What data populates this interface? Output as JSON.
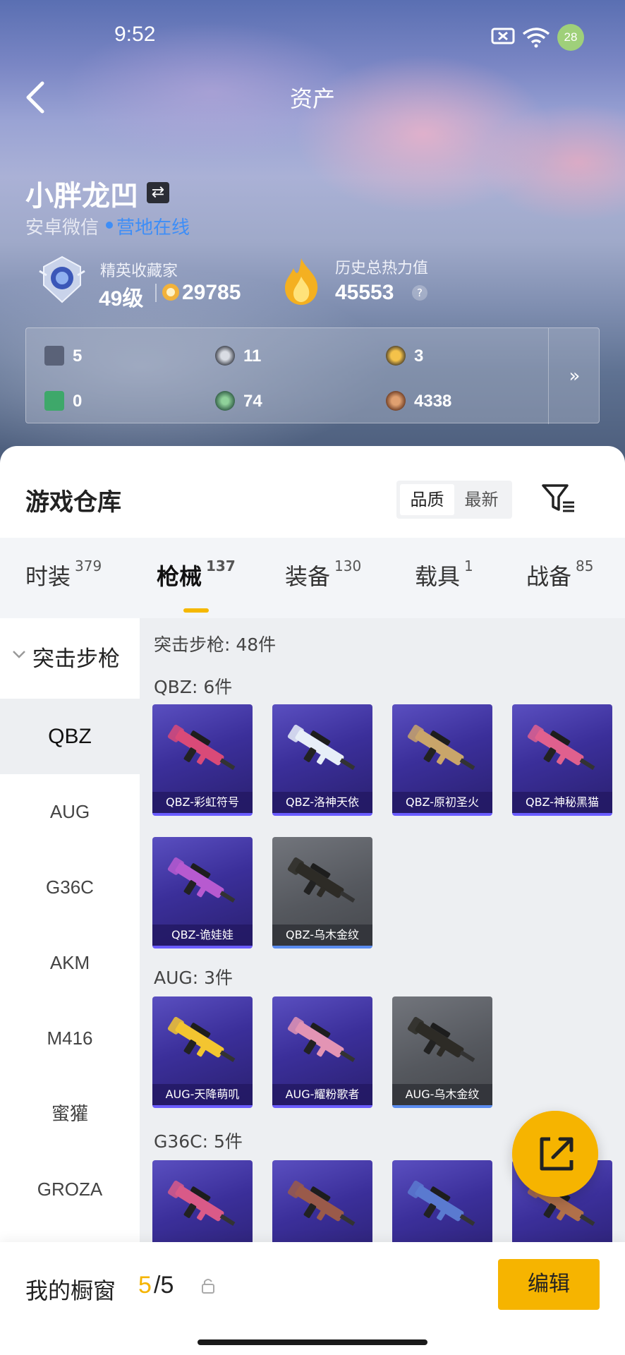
{
  "status_bar": {
    "time": "9:52",
    "battery": "28"
  },
  "header": {
    "title": "资产"
  },
  "profile": {
    "username": "小胖龙凹",
    "platform": "安卓微信",
    "online_status": "营地在线",
    "collector_title": "精英收藏家",
    "level": "49级",
    "coins": "29785",
    "heat_label": "历史总热力值",
    "heat_value": "45553",
    "help": "?"
  },
  "stats": [
    {
      "icon": "card-icon",
      "value": "5"
    },
    {
      "icon": "silver-coin-icon",
      "value": "11"
    },
    {
      "icon": "gold-coin-icon",
      "value": "3"
    },
    {
      "icon": "ticket-icon",
      "value": "0"
    },
    {
      "icon": "green-orb-icon",
      "value": "74"
    },
    {
      "icon": "bronze-coin-icon",
      "value": "4338"
    }
  ],
  "warehouse": {
    "title": "游戏仓库",
    "sort_options": [
      "品质",
      "最新"
    ],
    "active_sort": "品质"
  },
  "tabs": [
    {
      "label": "时装",
      "count": "379"
    },
    {
      "label": "枪械",
      "count": "137"
    },
    {
      "label": "装备",
      "count": "130"
    },
    {
      "label": "载具",
      "count": "1"
    },
    {
      "label": "战备",
      "count": "85"
    }
  ],
  "active_tab": "枪械",
  "sidebar": {
    "group": "突击步枪",
    "items": [
      "QBZ",
      "AUG",
      "G36C",
      "AKM",
      "M416",
      "蜜獾",
      "GROZA"
    ],
    "active": "QBZ"
  },
  "content": {
    "category_header": "突击步枪: 48件",
    "sections": [
      {
        "header": "QBZ: 6件",
        "items": [
          {
            "name": "QBZ-彩虹符号",
            "style": "purple",
            "gun": "#d94a78"
          },
          {
            "name": "QBZ-洛神天依",
            "style": "purple",
            "gun": "#e7eef8"
          },
          {
            "name": "QBZ-原初圣火",
            "style": "purple",
            "gun": "#c9a56a"
          },
          {
            "name": "QBZ-神秘黑猫",
            "style": "purple",
            "gun": "#e0608e"
          },
          {
            "name": "QBZ-诡娃娃",
            "style": "purple",
            "gun": "#b75ad0"
          },
          {
            "name": "QBZ-乌木金纹",
            "style": "gray",
            "gun": "#2d2b26"
          }
        ]
      },
      {
        "header": "AUG: 3件",
        "items": [
          {
            "name": "AUG-天降萌叽",
            "style": "purple",
            "gun": "#f3c530"
          },
          {
            "name": "AUG-耀粉歌者",
            "style": "purple",
            "gun": "#e394b4"
          },
          {
            "name": "AUG-乌木金纹",
            "style": "gray",
            "gun": "#2d2b26"
          }
        ]
      },
      {
        "header": "G36C: 5件",
        "items": [
          {
            "name": "",
            "style": "purple",
            "gun": "#d95a88"
          },
          {
            "name": "",
            "style": "purple",
            "gun": "#9a5a4a"
          },
          {
            "name": "",
            "style": "purple",
            "gun": "#5a7ad0"
          },
          {
            "name": "",
            "style": "purple",
            "gun": "#b0704a"
          }
        ]
      }
    ]
  },
  "bottom": {
    "showcase_label": "我的橱窗",
    "showcase_current": "5",
    "showcase_total": "/5",
    "edit_label": "编辑"
  },
  "colors": {
    "accent": "#f6b400",
    "online": "#3e8ef7",
    "card_purple": "#3b2f9a"
  }
}
